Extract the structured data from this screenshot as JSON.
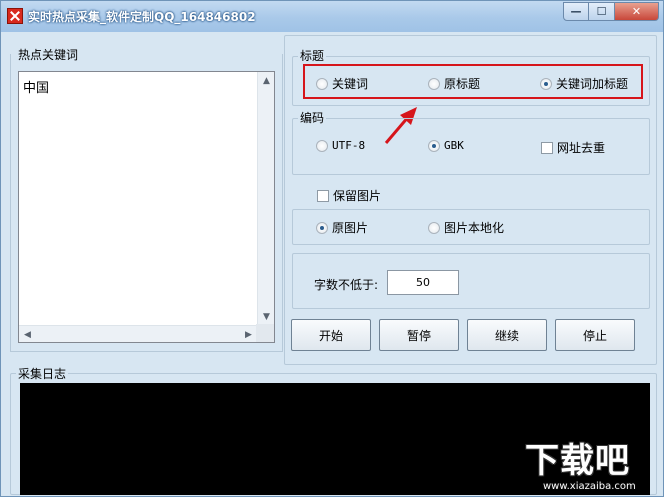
{
  "window": {
    "title": "实时热点采集_软件定制QQ_164846802",
    "controls": {
      "minimize": "—",
      "maximize": "☐",
      "close": "✕"
    }
  },
  "keywords_panel": {
    "label": "热点关键词",
    "items": [
      "中国"
    ]
  },
  "title_group": {
    "label": "标题",
    "options": [
      {
        "label": "关键词",
        "selected": false
      },
      {
        "label": "原标题",
        "selected": false
      },
      {
        "label": "关键词加标题",
        "selected": true
      }
    ]
  },
  "encoding_group": {
    "label": "编码",
    "options": [
      {
        "label": "UTF-8",
        "selected": false
      },
      {
        "label": "GBK",
        "selected": true
      }
    ],
    "dedupe_label": "网址去重",
    "dedupe_checked": false
  },
  "image_group": {
    "keep_images_label": "保留图片",
    "keep_images_checked": false,
    "options": [
      {
        "label": "原图片",
        "selected": true
      },
      {
        "label": "图片本地化",
        "selected": false
      }
    ]
  },
  "min_chars": {
    "label": "字数不低于:",
    "value": "50"
  },
  "buttons": {
    "start": "开始",
    "pause": "暂停",
    "resume": "继续",
    "stop": "停止"
  },
  "log": {
    "label": "采集日志"
  },
  "watermark": {
    "brand": "下载吧",
    "url": "www.xiazaiba.com"
  },
  "colors": {
    "highlight": "#d6151b",
    "arrow": "#d6151b",
    "log_background": "#000000"
  }
}
